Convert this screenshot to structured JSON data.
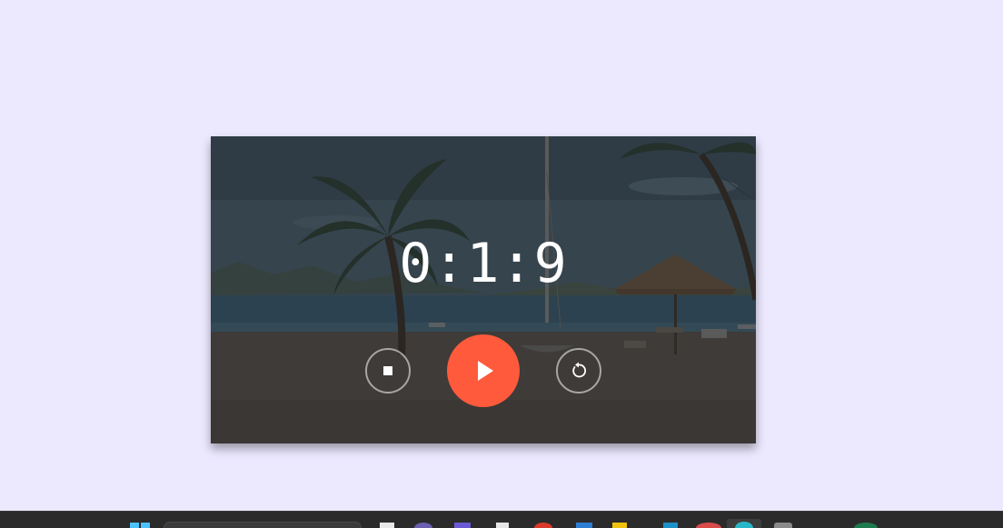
{
  "timer": {
    "display": "0:1:9"
  },
  "controls": {
    "stop_icon": "stop-icon",
    "play_icon": "play-icon",
    "reset_icon": "reset-icon",
    "accent_color": "#ff5a3c"
  },
  "background": {
    "page_color": "#ece9ff",
    "scene": "beach"
  },
  "taskbar": {
    "icons": [
      "windows-start-icon",
      "search-box",
      "app-icon",
      "app-icon",
      "app-icon",
      "app-icon",
      "app-icon",
      "app-icon",
      "app-icon",
      "app-icon",
      "app-icon",
      "app-icon",
      "app-icon",
      "app-icon"
    ]
  }
}
